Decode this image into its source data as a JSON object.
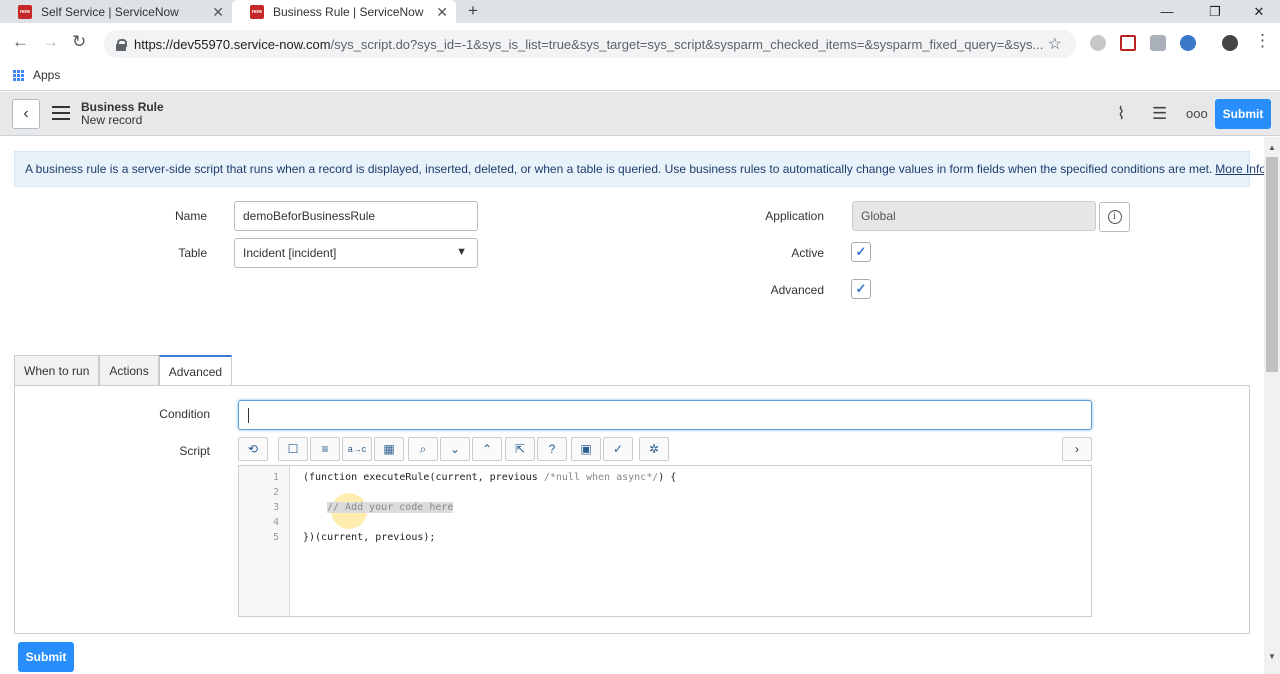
{
  "browser": {
    "tabs": [
      {
        "title": "Self Service | ServiceNow",
        "favicon": "now"
      },
      {
        "title": "Business Rule | ServiceNow",
        "favicon": "now"
      }
    ],
    "url_host": "https://dev55970.service-now.com",
    "url_path": "/sys_script.do?sys_id=-1&sys_is_list=true&sys_target=sys_script&sysparm_checked_items=&sysparm_fixed_query=&sys...",
    "bookmarks_label": "Apps"
  },
  "header": {
    "title": "Business Rule",
    "subtitle": "New record",
    "submit_label": "Submit"
  },
  "info": {
    "text": "A business rule is a server-side script that runs when a record is displayed, inserted, deleted, or when a table is queried. Use business rules to automatically change values in form fields when the specified conditions are met.",
    "link": "More Info"
  },
  "form": {
    "name_label": "Name",
    "name_value": "demoBeforBusinessRule",
    "table_label": "Table",
    "table_value": "Incident [incident]",
    "application_label": "Application",
    "application_value": "Global",
    "active_label": "Active",
    "active_checked": true,
    "advanced_label": "Advanced",
    "advanced_checked": true
  },
  "tabs": [
    "When to run",
    "Actions",
    "Advanced"
  ],
  "active_tab": "Advanced",
  "advanced": {
    "condition_label": "Condition",
    "condition_value": "",
    "script_label": "Script",
    "line_numbers": [
      "1",
      "2",
      "3",
      "4",
      "5"
    ],
    "code_line1_a": "(function ",
    "code_line1_b": "executeRule",
    "code_line1_c": "(current, previous ",
    "code_line1_d": "/*null when async*/",
    "code_line1_e": ") {",
    "code_line3": "// Add your code here",
    "code_line5": "})(current, previous);"
  },
  "footer": {
    "submit_label": "Submit"
  },
  "colors": {
    "accent": "#278efc",
    "info_bg": "#e8f2fa",
    "brand": "#c62828"
  }
}
